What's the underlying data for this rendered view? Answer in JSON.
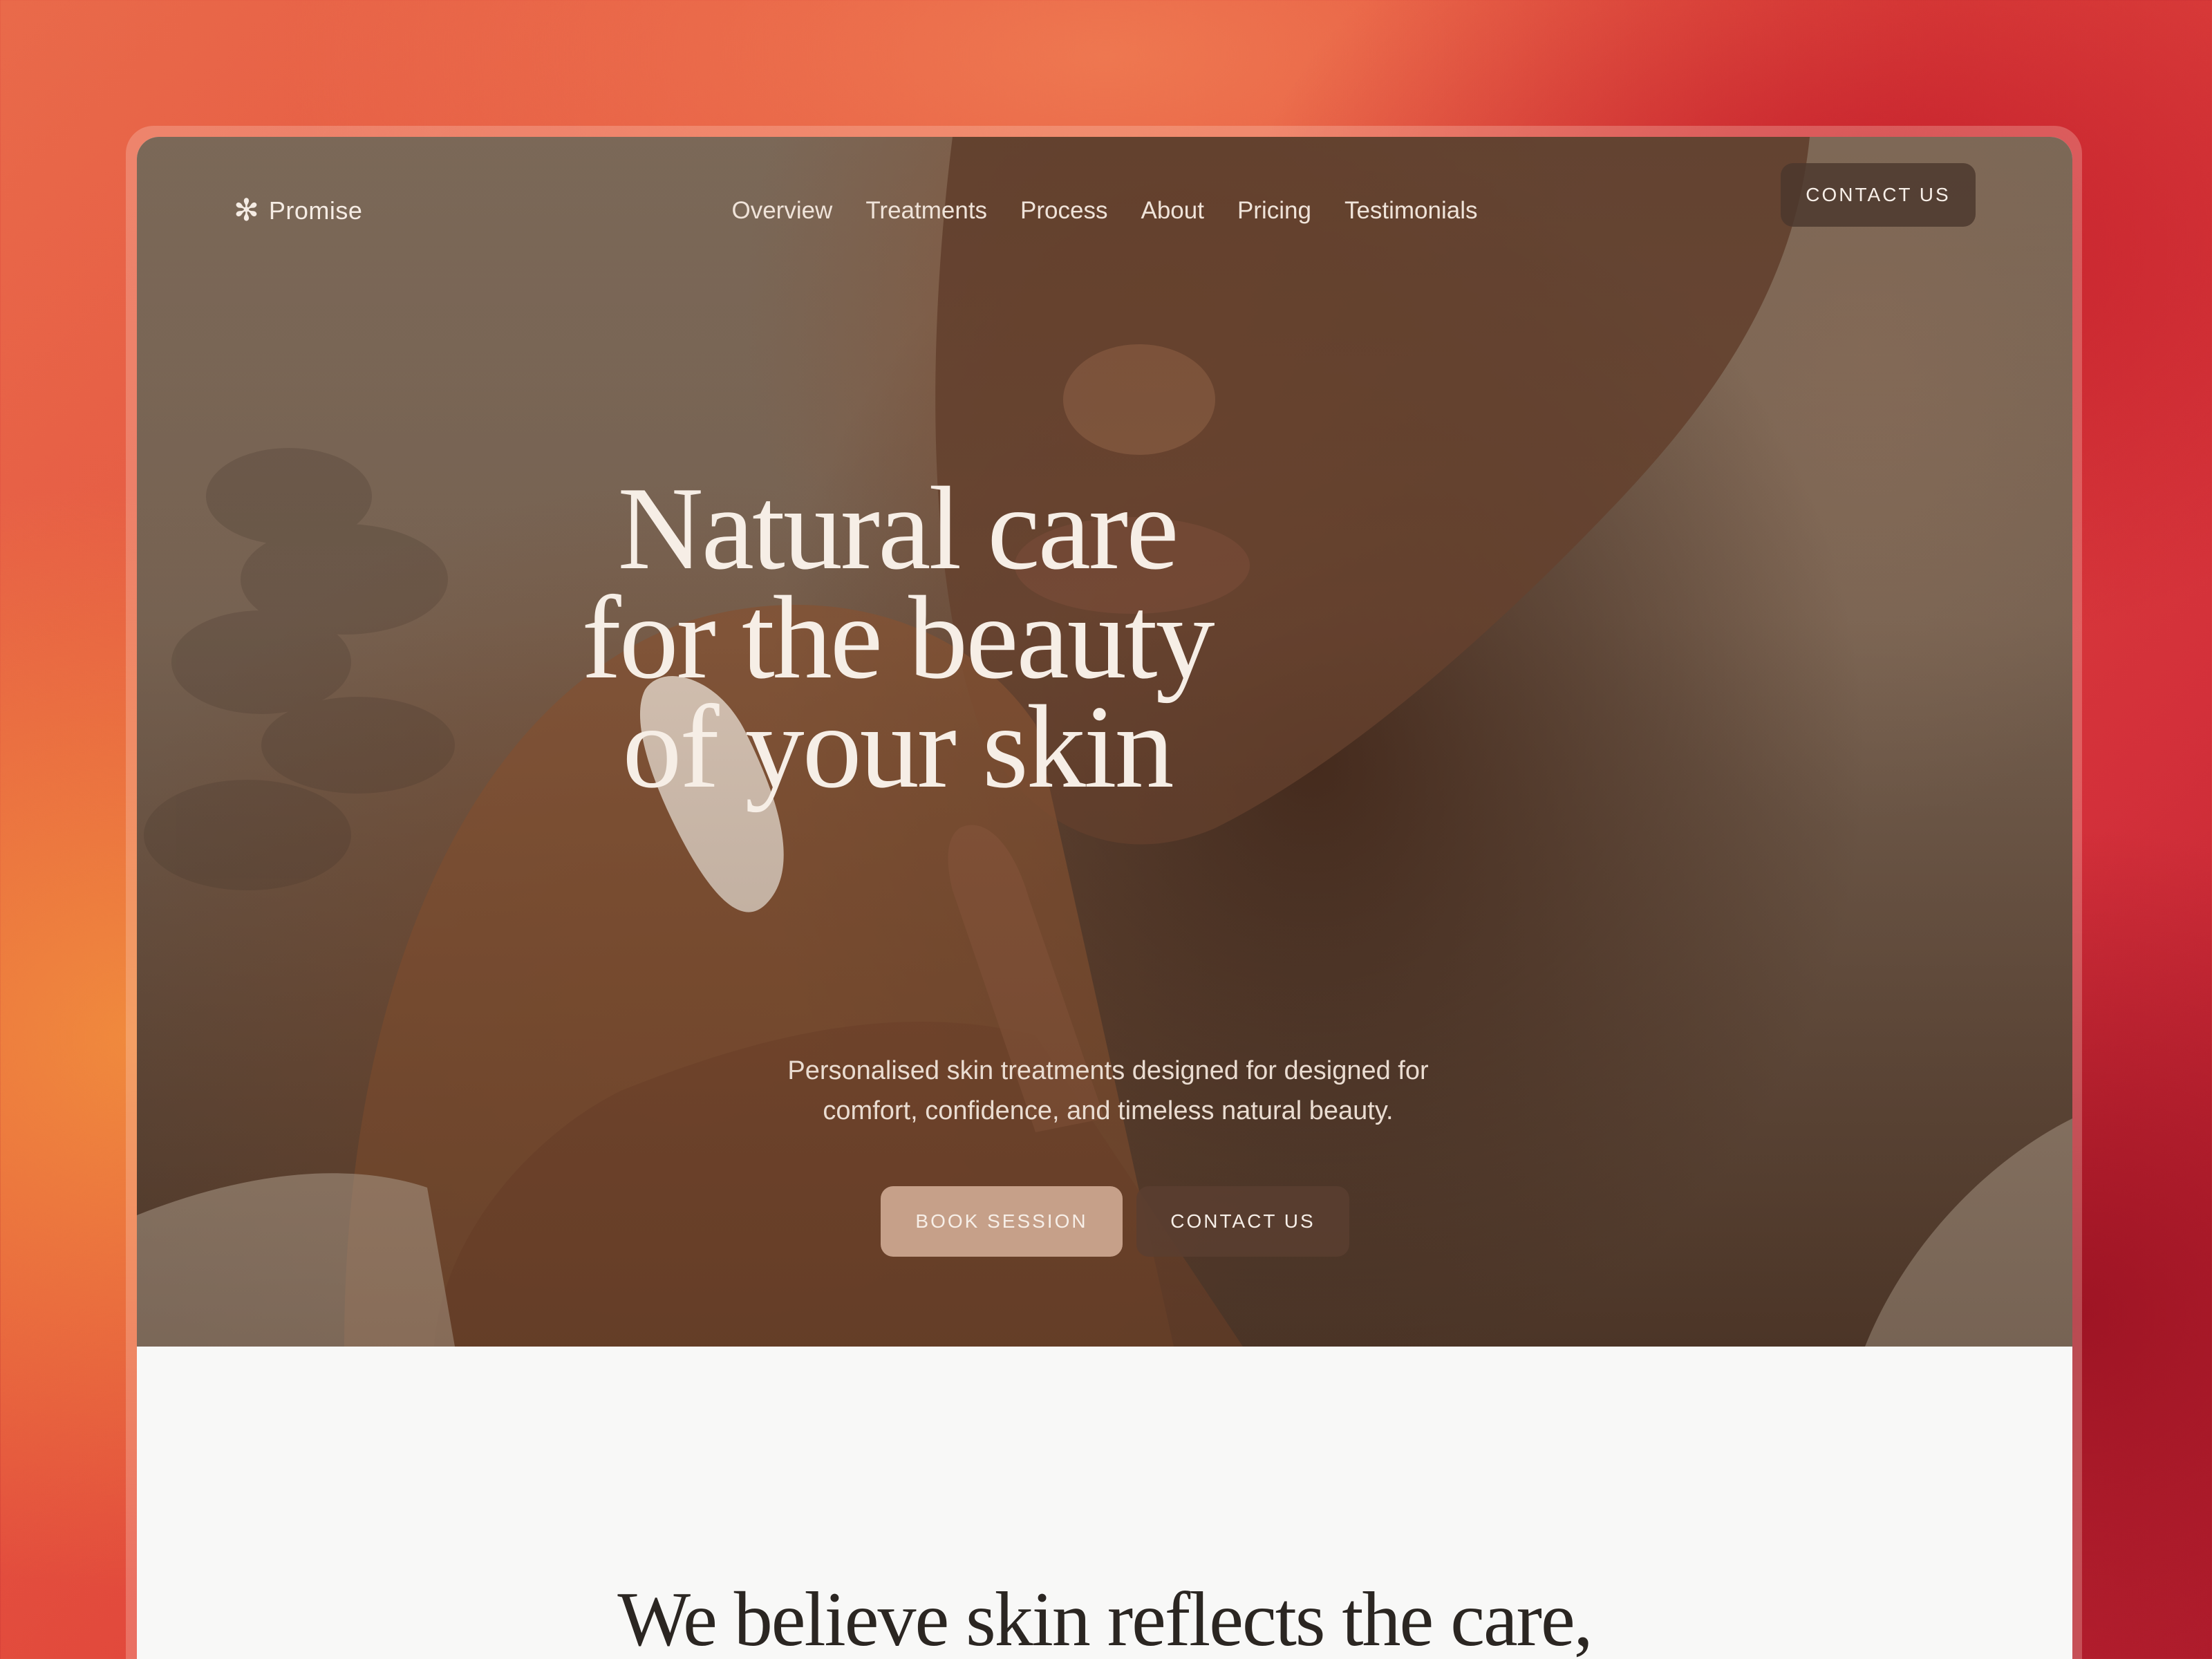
{
  "brand": {
    "name": "Promise",
    "icon": "asterisk-icon"
  },
  "nav": {
    "items": [
      "Overview",
      "Treatments",
      "Process",
      "About",
      "Pricing",
      "Testimonials"
    ],
    "contact_label": "CONTACT US"
  },
  "hero": {
    "headline_lines": [
      "Natural care",
      "for the beauty",
      "of your skin"
    ],
    "subtext_lines": [
      "Personalised skin treatments designed for designed for",
      "comfort, confidence, and timeless natural beauty."
    ],
    "book_label": "BOOK SESSION",
    "contact_label": "CONTACT US"
  },
  "section": {
    "title": "We believe skin reflects the care,"
  },
  "colors": {
    "background_accent": "#e24a3c",
    "book_button": "#c6a089",
    "contact_button": "#5a3e30",
    "page_bg": "#f8f8f7"
  }
}
